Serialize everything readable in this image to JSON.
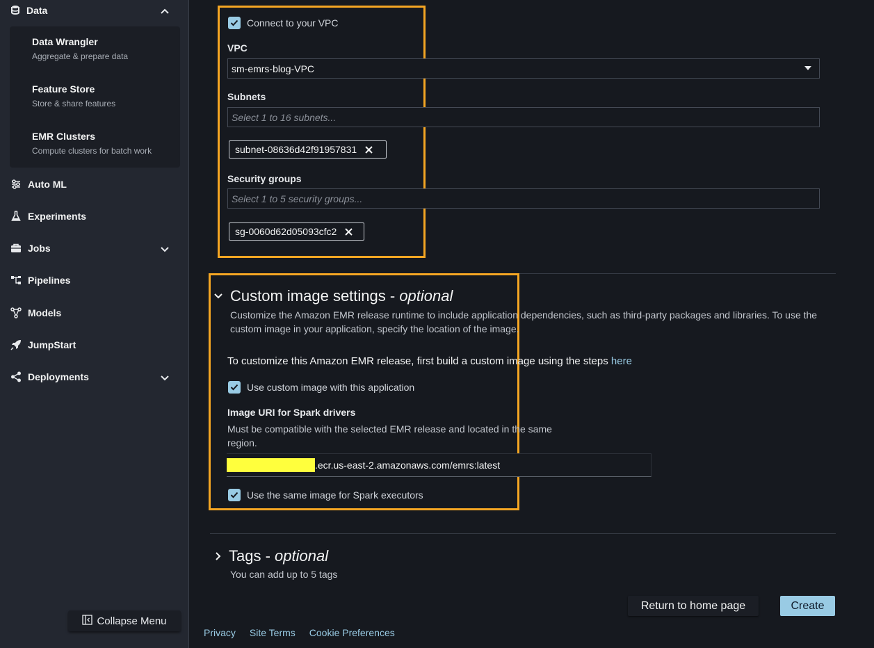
{
  "sidebar": {
    "data_section": "Data",
    "submenu": [
      {
        "title": "Data Wrangler",
        "desc": "Aggregate & prepare data"
      },
      {
        "title": "Feature Store",
        "desc": "Store & share features"
      },
      {
        "title": "EMR Clusters",
        "desc": "Compute clusters for batch work"
      }
    ],
    "items": [
      {
        "label": "Auto ML",
        "icon": "automl-icon"
      },
      {
        "label": "Experiments",
        "icon": "flask-icon"
      },
      {
        "label": "Jobs",
        "icon": "jobs-icon"
      },
      {
        "label": "Pipelines",
        "icon": "pipelines-icon"
      },
      {
        "label": "Models",
        "icon": "models-icon"
      },
      {
        "label": "JumpStart",
        "icon": "rocket-icon"
      },
      {
        "label": "Deployments",
        "icon": "share-icon"
      }
    ],
    "collapse_label": "Collapse Menu"
  },
  "vpc": {
    "connect_label": "Connect to your VPC",
    "connect_checked": true,
    "vpc_label": "VPC",
    "vpc_value": "sm-emrs-blog-VPC",
    "subnets_label": "Subnets",
    "subnets_placeholder": "Select 1 to 16 subnets...",
    "subnet_token": "subnet-08636d42f91957831",
    "sg_label": "Security groups",
    "sg_placeholder": "Select 1 to 5 security groups...",
    "sg_token": "sg-0060d62d05093cfc2"
  },
  "custom_image": {
    "title": "Custom image settings - ",
    "title_optional": "optional",
    "desc_line1": "Customize the Amazon EMR release runtime to include application dependencies, such as third-party packages and libraries. To use the",
    "desc_line2": "custom image in your application, specify the location of the image.",
    "steps_text": "To customize this Amazon EMR release, first build a custom image using the steps ",
    "steps_link": "here",
    "use_custom_label": "Use custom image with this application",
    "use_custom_checked": true,
    "uri_label": "Image URI for Spark drivers",
    "uri_desc_line1": "Must be compatible with the selected EMR release and located in the same",
    "uri_desc_line2": "region.",
    "uri_value": ".ecr.us-east-2.amazonaws.com/emrs:latest",
    "same_image_label": "Use the same image for Spark executors",
    "same_image_checked": true
  },
  "tags": {
    "title": "Tags - ",
    "title_optional": "optional",
    "desc": "You can add up to 5 tags"
  },
  "actions": {
    "home_label": "Return to home page",
    "create_label": "Create"
  },
  "footer": {
    "privacy": "Privacy",
    "site_terms": "Site Terms",
    "cookies": "Cookie Preferences"
  },
  "colors": {
    "accent": "#99cbe4",
    "highlight_border": "#f5a623",
    "background": "#16191f",
    "sidebar": "#232730"
  }
}
